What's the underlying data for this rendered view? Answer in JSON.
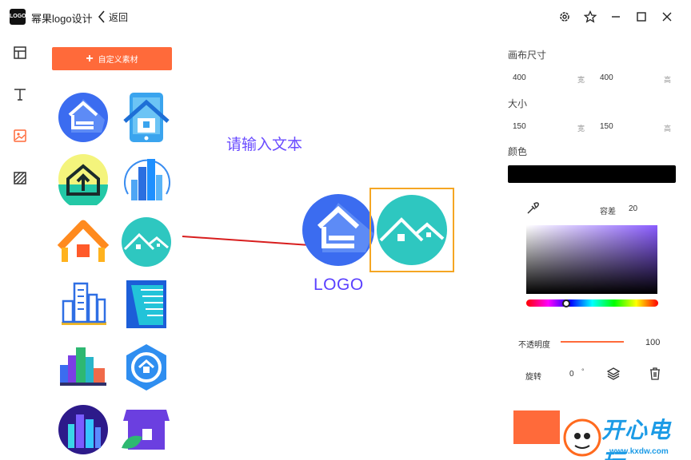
{
  "app": {
    "logo_badge": "LOGO",
    "title": "幂果logo设计",
    "back_label": "返回"
  },
  "toolbar": {
    "custom_material_label": "自定义素材"
  },
  "canvas": {
    "placeholder_text": "请输入文本",
    "logo_text": "LOGO"
  },
  "right_panel": {
    "canvas_size_label": "画布尺寸",
    "canvas_width": "400",
    "canvas_height": "400",
    "width_unit": "宽",
    "height_unit": "高",
    "size_label": "大小",
    "size_width": "150",
    "size_height": "150",
    "color_label": "颜色",
    "color_value": "#000000",
    "tolerance_label": "容差",
    "tolerance_value": "20",
    "opacity_label": "不透明度",
    "opacity_value": "100",
    "rotate_label": "旋转",
    "rotate_value": "0",
    "rotate_unit": "°"
  },
  "watermark": {
    "title": "开心电玩",
    "url": "www.kxdw.com"
  },
  "colors": {
    "accent": "#ff6a3a",
    "text_purple": "#6a4cff",
    "selection": "#f5a623",
    "teal": "#2ec7c0",
    "blue": "#3b6cf0"
  },
  "icons": [
    "settings-icon",
    "star-icon",
    "minimize-icon",
    "maximize-icon",
    "close-icon",
    "layout-icon",
    "text-icon",
    "image-icon",
    "pattern-icon",
    "eyedropper-icon",
    "layers-icon",
    "delete-icon"
  ]
}
